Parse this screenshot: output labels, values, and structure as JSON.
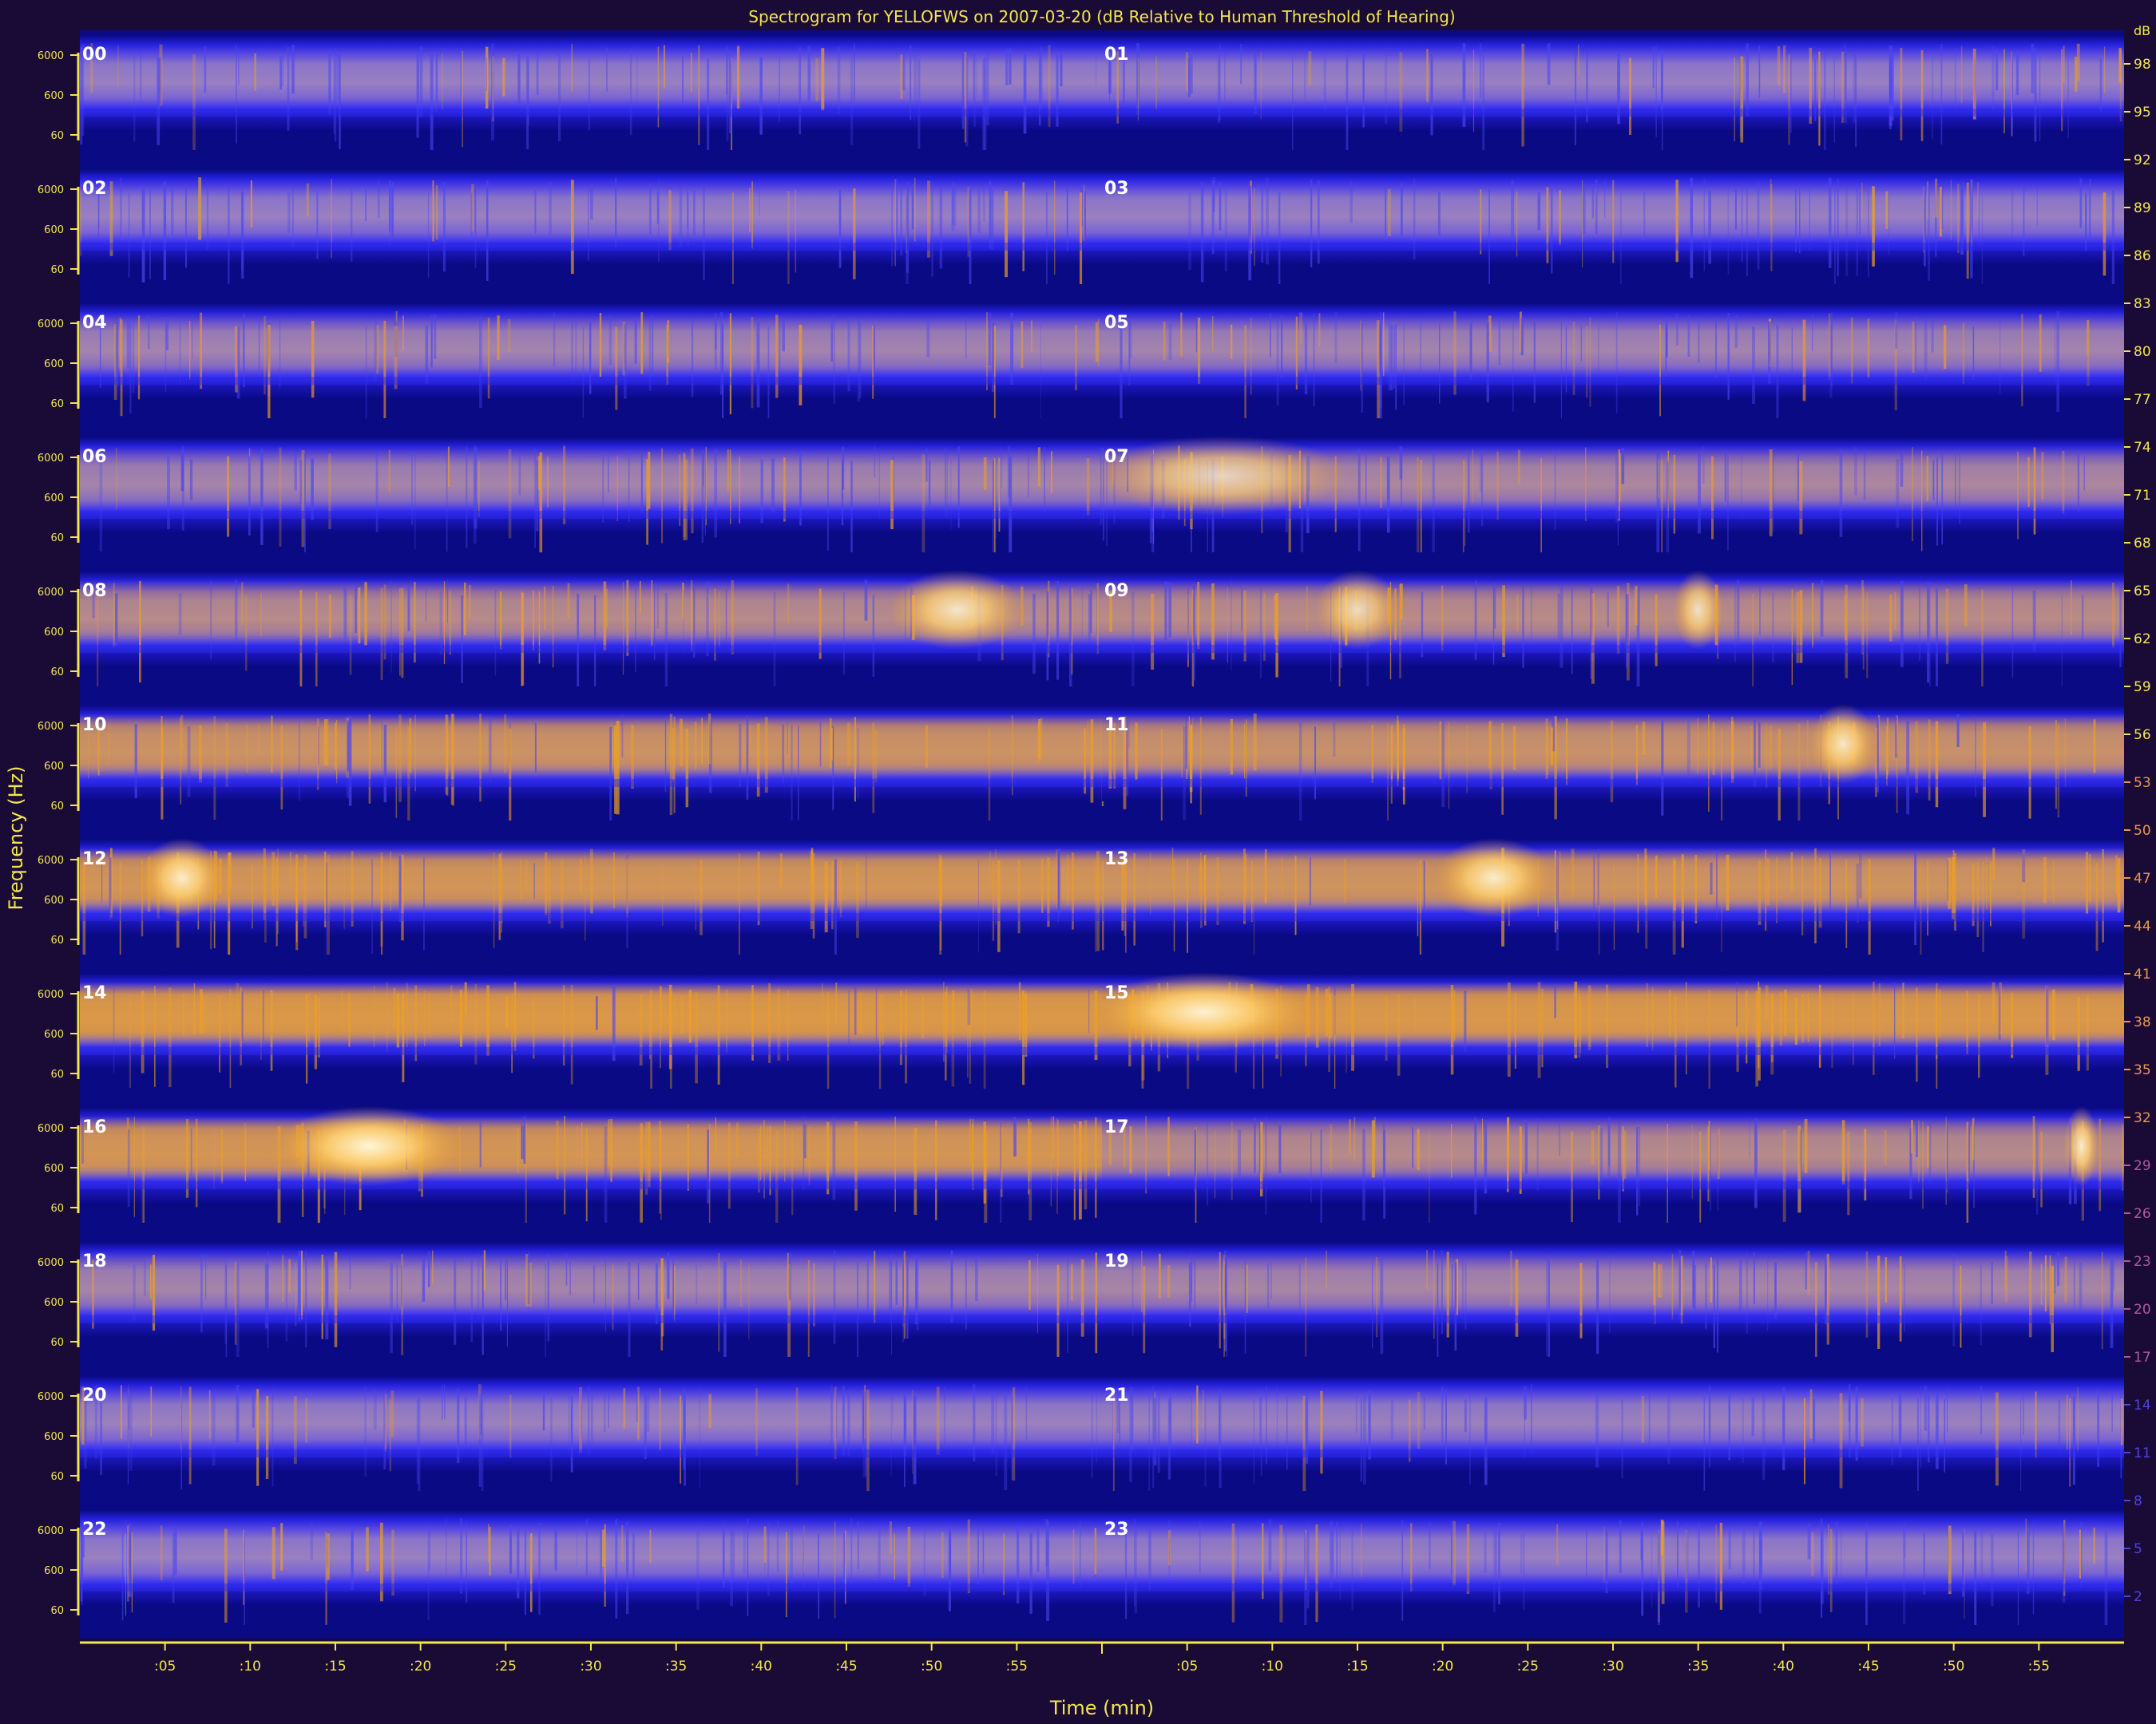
{
  "chart_data": {
    "type": "heatmap",
    "title": "Spectrogram for YELLOFWS on 2007-03-20 (dB Relative to Human Threshold of Hearing)",
    "xlabel": "Time (min)",
    "ylabel": "Frequency (Hz)",
    "y_tick_labels": [
      "6000",
      "600",
      "60"
    ],
    "x_tick_labels": [
      ":05",
      ":10",
      ":15",
      ":20",
      ":25",
      ":30",
      ":35",
      ":40",
      ":45",
      ":50",
      ":55"
    ],
    "hours": [
      "00",
      "01",
      "02",
      "03",
      "04",
      "05",
      "06",
      "07",
      "08",
      "09",
      "10",
      "11",
      "12",
      "13",
      "14",
      "15",
      "16",
      "17",
      "18",
      "19",
      "20",
      "21",
      "22",
      "23"
    ],
    "colorbar": {
      "ticks": [
        "98",
        "95",
        "92",
        "89",
        "86",
        "83",
        "80",
        "77",
        "74",
        "71",
        "68",
        "65",
        "62",
        "59",
        "56",
        "53",
        "50",
        "47",
        "44",
        "41",
        "38",
        "35",
        "32",
        "29",
        "26",
        "23",
        "20",
        "17",
        "14",
        "11",
        "8",
        "5",
        "2"
      ],
      "top_label": "dB",
      "range": [
        2,
        98
      ]
    },
    "band_intensity_by_hour": [
      0.28,
      0.28,
      0.25,
      0.25,
      0.4,
      0.4,
      0.42,
      0.48,
      0.58,
      0.6,
      0.78,
      0.74,
      0.84,
      0.8,
      0.92,
      0.9,
      0.85,
      0.58,
      0.42,
      0.44,
      0.32,
      0.32,
      0.3,
      0.3
    ],
    "hotspots": [
      {
        "hour": "16",
        "minute_start": 12,
        "minute_end": 22,
        "intensity": 1.0
      },
      {
        "hour": "08",
        "minute_start": 48,
        "minute_end": 55,
        "intensity": 0.85
      },
      {
        "hour": "12",
        "minute_start": 4,
        "minute_end": 8,
        "intensity": 0.9
      },
      {
        "hour": "13",
        "minute_start": 20,
        "minute_end": 26,
        "intensity": 0.9
      },
      {
        "hour": "07",
        "minute_start": 0,
        "minute_end": 14,
        "intensity": 0.7
      },
      {
        "hour": "09",
        "minute_start": 13,
        "minute_end": 17,
        "intensity": 0.75
      },
      {
        "hour": "09",
        "minute_start": 34,
        "minute_end": 36,
        "intensity": 0.8
      },
      {
        "hour": "15",
        "minute_start": 0,
        "minute_end": 12,
        "intensity": 0.95
      },
      {
        "hour": "11",
        "minute_start": 42,
        "minute_end": 45,
        "intensity": 0.85
      },
      {
        "hour": "17",
        "minute_start": 57,
        "minute_end": 58,
        "intensity": 0.9
      }
    ],
    "colors": {
      "background": "#1a0a36",
      "low": "#0a0a84",
      "mid": "#3a32f0",
      "band": "#8a6cb0",
      "high": "#f0a020",
      "peak": "#fff6d8",
      "text": "#f2e650"
    }
  }
}
